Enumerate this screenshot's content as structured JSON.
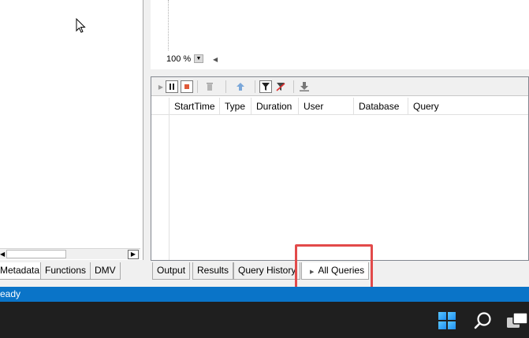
{
  "left_tabs": [
    {
      "label": "Metadata",
      "active": true
    },
    {
      "label": "Functions",
      "active": false
    },
    {
      "label": "DMV",
      "active": false
    }
  ],
  "editor": {
    "zoom": "100 %"
  },
  "trace": {
    "columns": [
      "StartTime",
      "Type",
      "Duration",
      "User",
      "Database",
      "Query"
    ]
  },
  "bottom_tabs": [
    {
      "label": "Output"
    },
    {
      "label": "Results"
    },
    {
      "label": "Query History"
    },
    {
      "label": "All Queries"
    }
  ],
  "status": {
    "text": "eady"
  },
  "colors": {
    "status_bar": "#0a74c8",
    "highlight": "#e24a4a",
    "taskbar": "#1f1f1f"
  },
  "icons": {
    "cursor": "mouse-pointer-icon",
    "play": "play-icon",
    "pause": "pause-icon",
    "stop": "stop-icon",
    "clear": "trash-icon",
    "scroll_top": "arrow-up-icon",
    "filter": "filter-icon",
    "clear_filter": "filter-clear-icon",
    "export": "download-icon"
  }
}
